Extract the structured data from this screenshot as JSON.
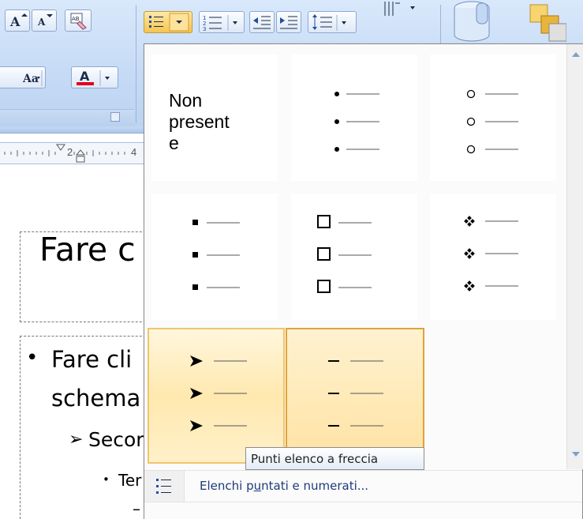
{
  "slide": {
    "title": "Fare c",
    "bullet1_line1": "Fare cli",
    "bullet1_line2": "schema",
    "bullet2": "Secor",
    "bullet3": "Ter"
  },
  "ribbon": {
    "ruler_num1": "2",
    "ruler_num2": "4"
  },
  "gallery": {
    "none_label": "Non\npresent\ne",
    "markers": [
      "bullet-dot",
      "hollow-circle",
      "filled-square",
      "hollow-square",
      "four-diamond",
      "arrow",
      "dash"
    ]
  },
  "tooltip": {
    "text": "Punti elenco a freccia"
  },
  "footer": {
    "label_before": "Elenchi p",
    "label_underline": "u",
    "label_after": "ntati e numerati..."
  },
  "colors": {
    "selection_border": "#f0c56a",
    "ribbon_bg": "#c5daf5",
    "footer_text": "#1f3a7a"
  }
}
